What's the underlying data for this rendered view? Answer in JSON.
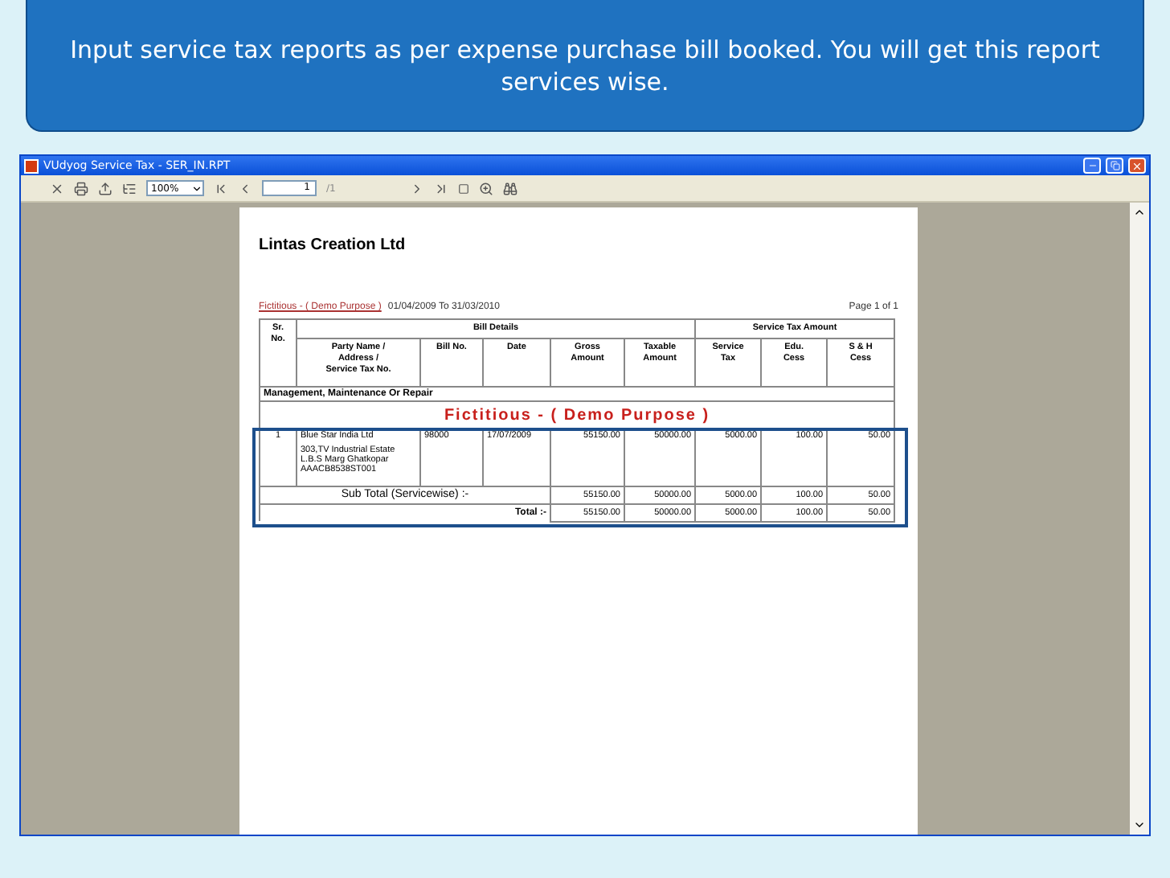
{
  "banner": {
    "text": "Input service tax reports as per expense purchase bill booked. You will get this report services wise."
  },
  "window": {
    "title": "VUdyog Service Tax - SER_IN.RPT"
  },
  "toolbar": {
    "zoom": "100%",
    "page": "1",
    "page_of": "/1"
  },
  "report": {
    "company": "Lintas Creation Ltd",
    "watermark_small": "Fictitious - ( Demo Purpose )",
    "period": "01/04/2009 To  31/03/2010",
    "page": "Page 1 of 1",
    "sr_header": "Sr.\nNo.",
    "group_headers": [
      "Bill Details",
      "Service Tax Amount"
    ],
    "columns": [
      "Party Name /\nAddress /\nService Tax No.",
      "Bill No.",
      "Date",
      "Gross\nAmount",
      "Taxable\nAmount",
      "Service\nTax",
      "Edu.\nCess",
      "S & H\nCess"
    ],
    "section": "Management, Maintenance Or Repair",
    "watermark": "Fictitious - ( Demo Purpose )",
    "rows": [
      {
        "sr": "1",
        "party": "Blue Star India Ltd",
        "address": "303,TV Industrial Estate\nL.B.S Marg Ghatkopar\nAAACB8538ST001",
        "values": [
          "98000",
          "17/07/2009",
          "55150.00",
          "50000.00",
          "5000.00",
          "100.00",
          "50.00"
        ]
      }
    ],
    "subtotal": {
      "label": "Sub Total (Servicewise) :-",
      "values": [
        "55150.00",
        "50000.00",
        "5000.00",
        "100.00",
        "50.00"
      ]
    },
    "total": {
      "label": "Total :-",
      "values": [
        "55150.00",
        "50000.00",
        "5000.00",
        "100.00",
        "50.00"
      ]
    }
  }
}
